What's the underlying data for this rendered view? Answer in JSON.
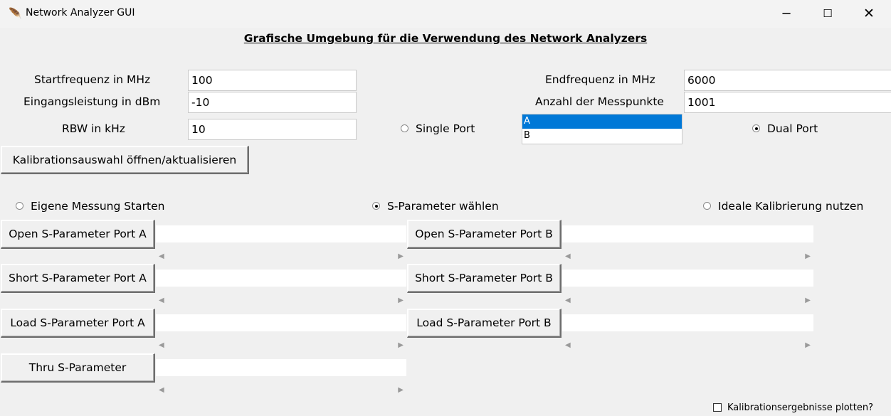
{
  "window": {
    "title": "Network Analyzer GUI",
    "controls": {
      "minimize": "─",
      "maximize": "☐",
      "close": "✕"
    }
  },
  "heading": "Grafische Umgebung für die Verwendung des Network Analyzers",
  "params": {
    "start_freq": {
      "label": "Startfrequenz in MHz",
      "value": "100"
    },
    "input_power": {
      "label": "Eingangsleistung in dBm",
      "value": "-10"
    },
    "rbw": {
      "label": "RBW in kHz",
      "value": "10"
    },
    "end_freq": {
      "label": "Endfrequenz in MHz",
      "value": "6000"
    },
    "points": {
      "label": "Anzahl der Messpunkte",
      "value": "1001"
    }
  },
  "port_mode": {
    "single": {
      "label": "Single Port",
      "selected": false
    },
    "dual": {
      "label": "Dual Port",
      "selected": true
    },
    "list": [
      {
        "label": "A",
        "selected": true
      },
      {
        "label": "B",
        "selected": false
      }
    ]
  },
  "calib_button": "Kalibrationsauswahl öffnen/aktualisieren",
  "mode": {
    "own": {
      "label": "Eigene Messung Starten",
      "selected": false
    },
    "sparam": {
      "label": "S-Parameter wählen",
      "selected": true
    },
    "ideal": {
      "label": "Ideale Kalibrierung nutzen",
      "selected": false
    }
  },
  "sparam_buttons": {
    "open_a": "Open S-Parameter Port A",
    "open_b": "Open S-Parameter Port B",
    "short_a": "Short S-Parameter Port A",
    "short_b": "Short S-Parameter Port B",
    "load_a": "Load S-Parameter Port A",
    "load_b": "Load S-Parameter Port B",
    "thru": "Thru S-Parameter"
  },
  "scroll_arrows": {
    "left": "◀",
    "right": "▶"
  },
  "plot_checkbox": {
    "label": "Kalibrationsergebnisse plotten?",
    "checked": false
  }
}
